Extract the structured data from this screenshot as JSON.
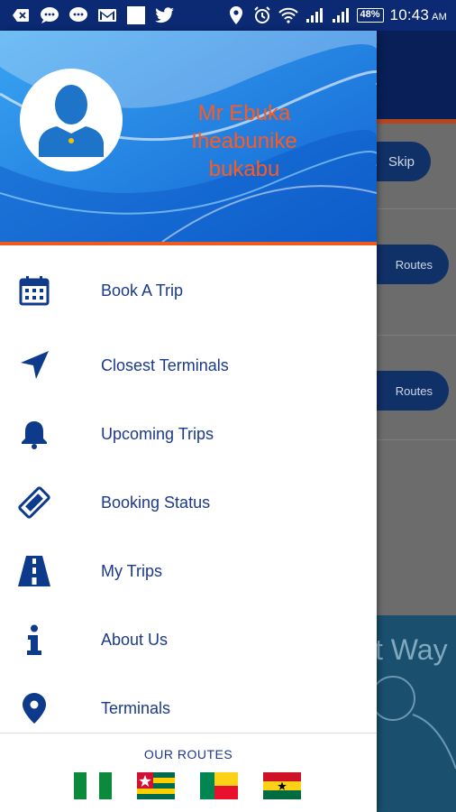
{
  "status_bar": {
    "time": "10:43",
    "ampm": "AM",
    "battery": "48%"
  },
  "drawer": {
    "user_name_lines": [
      "Mr Ebuka",
      "Iheabunike",
      "bukabu"
    ],
    "menu": [
      {
        "label": "Book A Trip",
        "icon": "calendar-icon"
      },
      {
        "label": "Closest Terminals",
        "icon": "navigation-arrow-icon"
      },
      {
        "label": "Upcoming Trips",
        "icon": "bell-icon"
      },
      {
        "label": "Booking Status",
        "icon": "ticket-icon"
      },
      {
        "label": "My Trips",
        "icon": "road-icon"
      },
      {
        "label": "About Us",
        "icon": "info-icon"
      },
      {
        "label": "Terminals",
        "icon": "map-pin-icon"
      }
    ],
    "routes_title": "OUR ROUTES",
    "route_flags": [
      "Nigeria",
      "Togo",
      "Benin",
      "Ghana"
    ]
  },
  "background_app": {
    "skip_label": "Skip",
    "routes_label_1": "Routes",
    "routes_label_2": "Routes",
    "footer_text": "t Way"
  },
  "colors": {
    "status_bar": "#0b2a73",
    "header_blue": "#1a7de0",
    "accent_orange": "#ef5a1f",
    "menu_text": "#1b3a8c",
    "icon_blue": "#0d3a8a"
  }
}
